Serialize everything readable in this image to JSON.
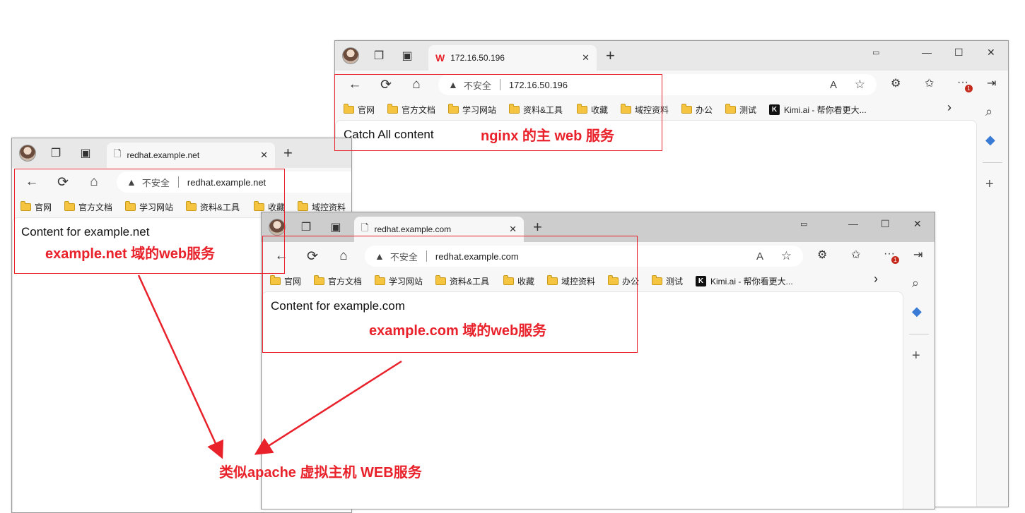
{
  "colors": {
    "annotation_red": "#e8212a",
    "folder": "#f5c542",
    "tab_bg": "#f7f7f7",
    "titlebar_bg": "#e8e8e8"
  },
  "icons": {
    "back": "←",
    "refresh": "⟳",
    "home": "⌂",
    "warning": "▲",
    "close": "✕",
    "plus": "+",
    "minimize": "—",
    "maximize": "☐",
    "read_aloud": "A",
    "star": "☆",
    "extensions": "⚙",
    "favorites": "✩",
    "more": "···",
    "split": "⇥",
    "search": "🔍",
    "tag": "◆",
    "chevron_right": "›",
    "collections": "❐",
    "tabs": "▣",
    "page": "🗋",
    "wps": "W",
    "kimi": "K"
  },
  "bookmarks": [
    "官网",
    "官方文档",
    "学习网站",
    "资料&工具",
    "收藏",
    "域控资料",
    "办公",
    "测试",
    "Kimi.ai - 帮你看更大..."
  ],
  "address_insecure": "不安全",
  "windows": {
    "ip": {
      "tab_title": "172.16.50.196",
      "url": "172.16.50.196",
      "content_text": "Catch All content",
      "notification_badge": "1"
    },
    "net": {
      "tab_title": "redhat.example.net",
      "url": "redhat.example.net",
      "content_text": "Content for example.net"
    },
    "com": {
      "tab_title": "redhat.example.com",
      "url": "redhat.example.com",
      "content_text": "Content for example.com",
      "notification_badge": "1"
    }
  },
  "annotations": {
    "nginx": "nginx 的主 web 服务",
    "net": "example.net 域的web服务",
    "com": "example.com 域的web服务",
    "apache": "类似apache 虚拟主机 WEB服务"
  }
}
